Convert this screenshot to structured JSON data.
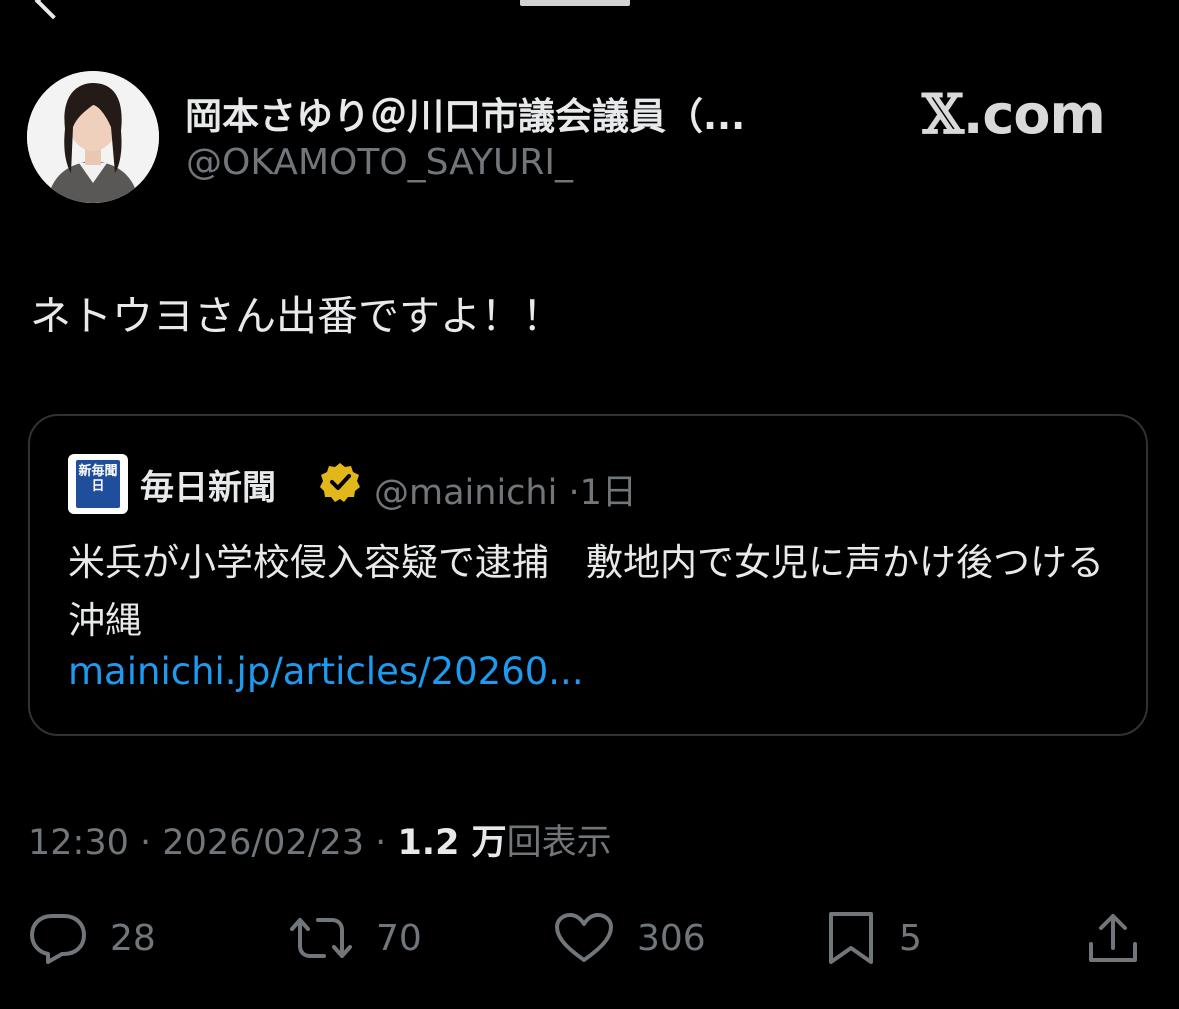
{
  "header": {
    "display_name": "岡本さゆり＠川口市議会議員（...",
    "handle": "@OKAMOTO_SAYURI_",
    "watermark": "X.com"
  },
  "tweet": {
    "text": "ネトウヨさん出番ですよ！！"
  },
  "quote": {
    "logo_text": "新毎聞日",
    "name": "毎日新聞",
    "handle": "@mainichi",
    "separator": "·",
    "age": "1日",
    "body": "米兵が小学校侵入容疑で逮捕　敷地内で女児に声かけ後つける　沖縄",
    "link": "mainichi.jp/articles/20260..."
  },
  "meta": {
    "time": "12:30",
    "date": "2026/02/23",
    "separator": "·",
    "views_count": "1.2 万",
    "views_label": "回表示"
  },
  "actions": {
    "replies": "28",
    "reposts": "70",
    "likes": "306",
    "bookmarks": "5"
  },
  "colors": {
    "background": "#000000",
    "text_primary": "#e7e9ea",
    "text_secondary": "#71767b",
    "link": "#1d9bf0",
    "verified_gold": "#e2b719",
    "border": "#2f3336"
  }
}
